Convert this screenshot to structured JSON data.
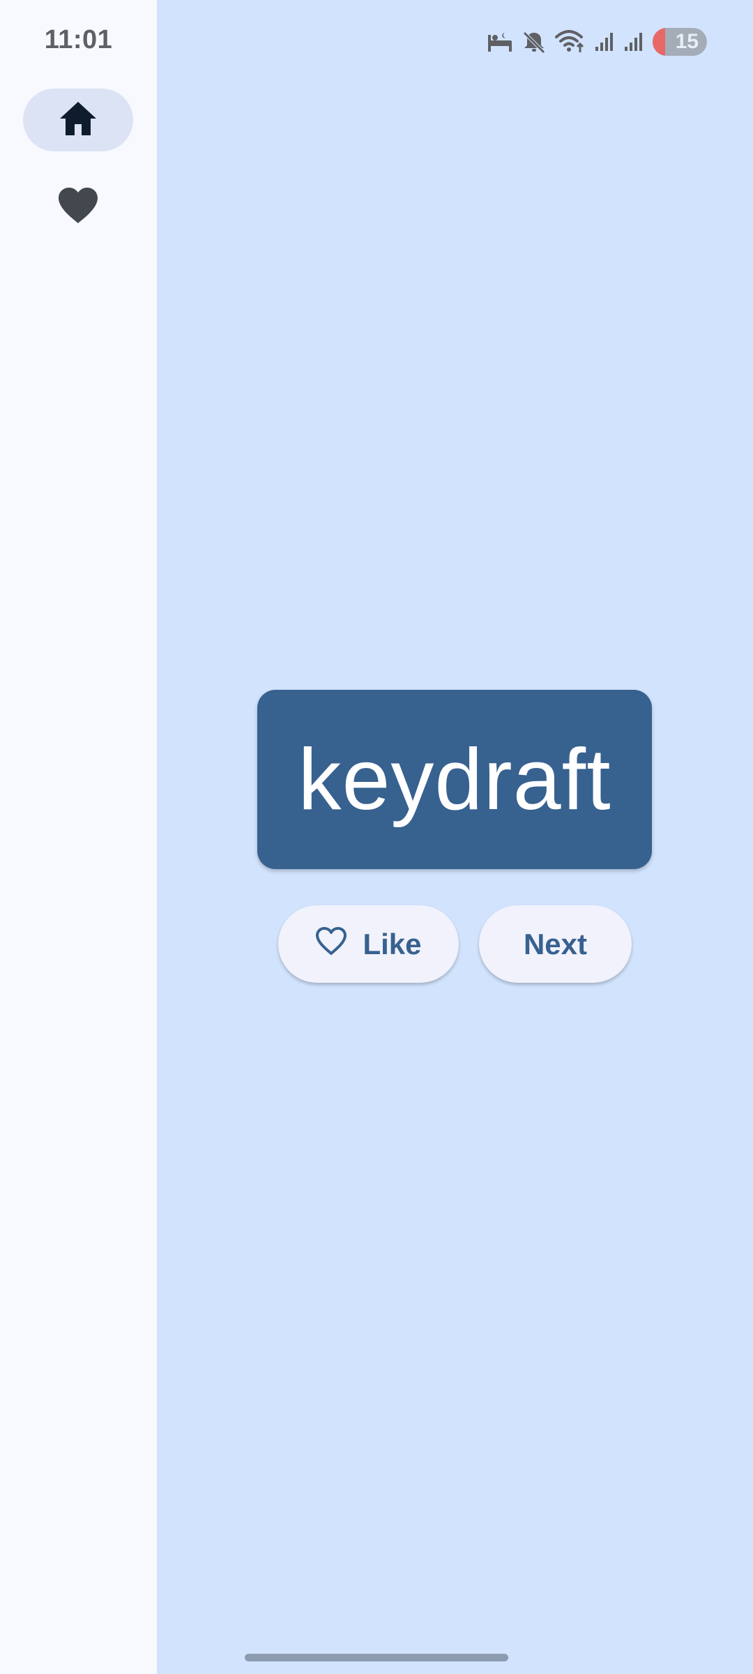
{
  "status_bar": {
    "time": "11:01",
    "battery_level": "15",
    "icons": [
      "sleep-icon",
      "mute-icon",
      "wifi-icon",
      "signal-icon",
      "signal-icon",
      "battery-icon"
    ]
  },
  "nav": {
    "items": [
      {
        "name": "home",
        "icon": "home-icon",
        "selected": true
      },
      {
        "name": "favorites",
        "icon": "heart-icon",
        "selected": false
      }
    ]
  },
  "card": {
    "word": "keydraft"
  },
  "actions": {
    "like_label": "Like",
    "next_label": "Next"
  },
  "colors": {
    "background": "#d1e3fd",
    "rail": "#f8f9ff",
    "card": "#37618f",
    "button": "#f1f2fb",
    "accent": "#37618f"
  }
}
